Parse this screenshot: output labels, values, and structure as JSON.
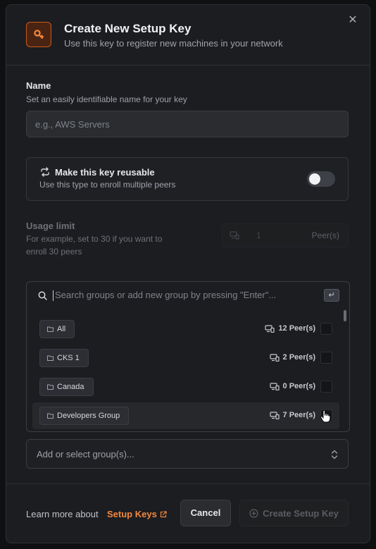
{
  "header": {
    "title": "Create New Setup Key",
    "subtitle": "Use this key to register new machines in your network",
    "close": "✕"
  },
  "name_field": {
    "label": "Name",
    "help": "Set an easily identifiable name for your key",
    "placeholder": "e.g., AWS Servers"
  },
  "reusable": {
    "title": "Make this key reusable",
    "help": "Use this type to enroll multiple peers",
    "enabled": false
  },
  "usage_limit": {
    "label": "Usage limit",
    "help": "For example, set to 30 if you want to enroll 30 peers",
    "value": "1",
    "unit": "Peer(s)"
  },
  "groups": {
    "search_placeholder": "Search groups or add new group by pressing \"Enter\"...",
    "enter_hint": "↵",
    "items": [
      {
        "name": "All",
        "peers": "12 Peer(s)"
      },
      {
        "name": "CKS 1",
        "peers": "2 Peer(s)"
      },
      {
        "name": "Canada",
        "peers": "0 Peer(s)"
      },
      {
        "name": "Developers Group",
        "peers": "7 Peer(s)"
      }
    ],
    "select_placeholder": "Add or select group(s)..."
  },
  "footer": {
    "learn_text": "Learn more about",
    "learn_link": "Setup Keys",
    "cancel": "Cancel",
    "create": "Create Setup Key"
  },
  "colors": {
    "accent": "#f2873d",
    "background": "#1c1d20"
  }
}
